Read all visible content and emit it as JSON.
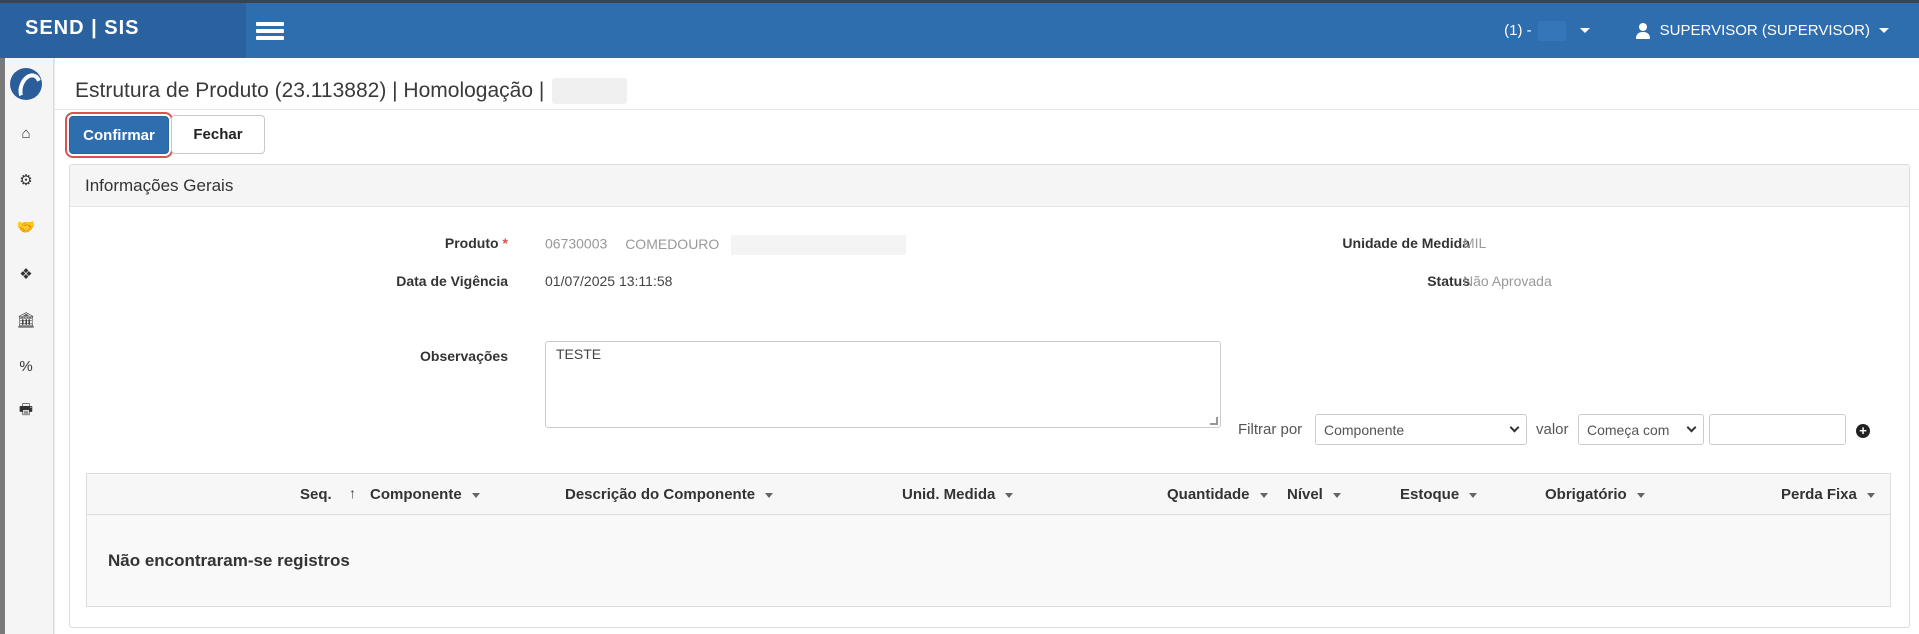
{
  "topbar": {
    "brand": "SEND | SIS",
    "company_label": "(1) -",
    "user_label": "SUPERVISOR (SUPERVISOR)"
  },
  "sidebar": {
    "items": [
      {
        "icon": "home-icon",
        "glyph": "⌂"
      },
      {
        "icon": "cogs-icon",
        "glyph": "⚙"
      },
      {
        "icon": "handshake-icon",
        "glyph": "🤝"
      },
      {
        "icon": "cubes-icon",
        "glyph": "❖"
      },
      {
        "icon": "bank-icon",
        "glyph": "🏛"
      },
      {
        "icon": "percent-icon",
        "glyph": "%"
      },
      {
        "icon": "print-icon",
        "glyph": "🖶"
      }
    ]
  },
  "page": {
    "title": "Estrutura de Produto (23.113882) | Homologação |"
  },
  "toolbar": {
    "confirm_label": "Confirmar",
    "close_label": "Fechar"
  },
  "panel": {
    "heading": "Informações Gerais"
  },
  "form": {
    "produto_label": "Produto",
    "required_mark": "*",
    "produto_code": "06730003",
    "produto_name": "COMEDOURO",
    "vigencia_label": "Data de Vigência",
    "vigencia_value": "01/07/2025 13:11:58",
    "obs_label": "Observações",
    "obs_value": "TESTE",
    "unidade_label": "Unidade de Medida",
    "unidade_value": "MIL",
    "status_label": "Status",
    "status_value": "Não Aprovada"
  },
  "filter": {
    "filtrar_label": "Filtrar por",
    "field_value": "Componente",
    "valor_label": "valor",
    "mode_value": "Começa com",
    "text_value": ""
  },
  "grid": {
    "columns": [
      "Seq.",
      "Componente",
      "Descrição do Componente",
      "Unid. Medida",
      "Quantidade",
      "Nível",
      "Estoque",
      "Obrigatório",
      "Perda Fixa"
    ],
    "sort_glyph": "↑",
    "empty_message": "Não encontraram-se registros"
  },
  "colors": {
    "topbar": "#2f6eae",
    "brand_bg": "#2a62a0",
    "primary_button": "#2f6eae",
    "focus_ring": "#d9534f",
    "required": "#d9534f"
  }
}
